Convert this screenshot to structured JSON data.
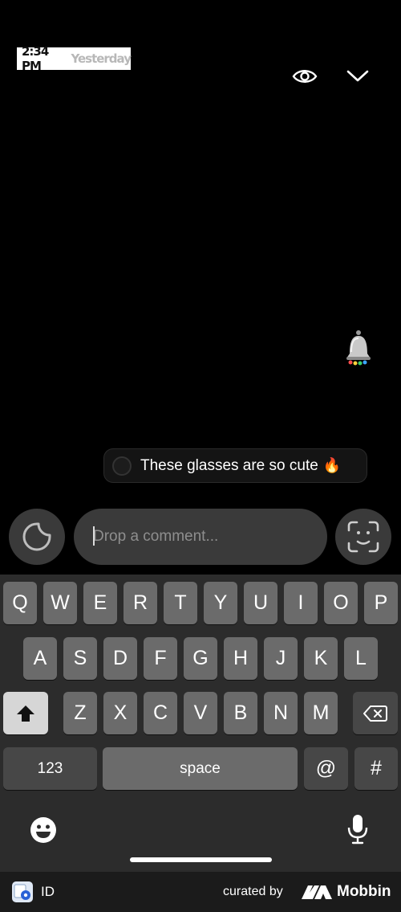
{
  "story": {
    "time": "2:34 PM",
    "day": "Yesterday",
    "comment_text": "These glasses are so cute",
    "comment_emoji": "🔥"
  },
  "icons": {
    "eye": "eye-icon",
    "chevron": "chevron-down-icon",
    "bell": "bell-sticker",
    "sticker": "sticker-icon",
    "face": "face-scan-icon",
    "emoji": "emoji-icon",
    "mic": "microphone-icon",
    "shift": "shift-icon",
    "backspace": "backspace-icon"
  },
  "comment_input": {
    "placeholder": "Drop a comment..."
  },
  "keyboard": {
    "row1": [
      "Q",
      "W",
      "E",
      "R",
      "T",
      "Y",
      "U",
      "I",
      "O",
      "P"
    ],
    "row2": [
      "A",
      "S",
      "D",
      "F",
      "G",
      "H",
      "J",
      "K",
      "L"
    ],
    "row3": [
      "Z",
      "X",
      "C",
      "V",
      "B",
      "N",
      "M"
    ],
    "num_label": "123",
    "space_label": "space",
    "at_label": "@",
    "hash_label": "#"
  },
  "footer": {
    "id_label": "ID",
    "curated_by": "curated by",
    "brand": "Mobbin"
  }
}
